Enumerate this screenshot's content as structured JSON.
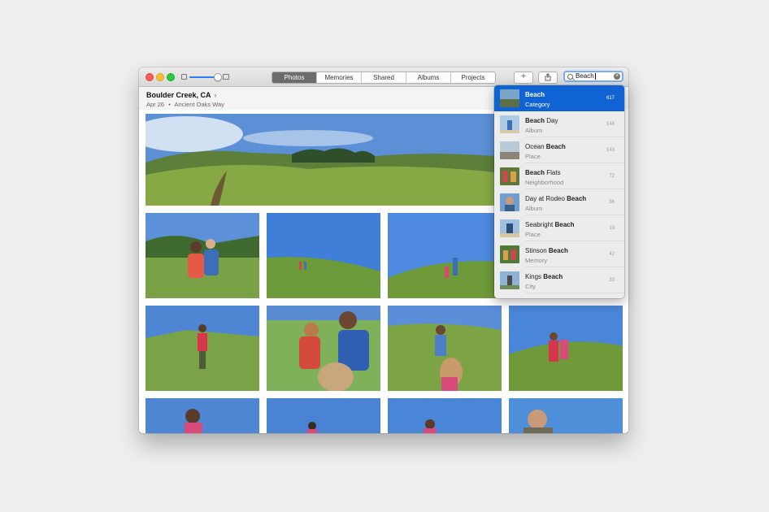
{
  "window": {
    "tabs": [
      {
        "label": "Photos",
        "active": true
      },
      {
        "label": "Memories",
        "active": false
      },
      {
        "label": "Shared",
        "active": false
      },
      {
        "label": "Albums",
        "active": false
      },
      {
        "label": "Projects",
        "active": false
      }
    ],
    "add_button": "+",
    "share_icon": "share-icon",
    "search": {
      "value": "Beach",
      "clear_icon": "clear-icon"
    }
  },
  "moment": {
    "location": "Boulder Creek, CA",
    "chevron": "›",
    "date": "Apr 26",
    "separator": "•",
    "place_name": "Ancient Oaks Way"
  },
  "suggestions": [
    {
      "match": "Beach",
      "prefix": "",
      "suffix": "",
      "type": "Category",
      "count": "617",
      "selected": true
    },
    {
      "match": "Beach",
      "prefix": "",
      "suffix": " Day",
      "type": "Album",
      "count": "148",
      "selected": false
    },
    {
      "match": "Beach",
      "prefix": "Ocean ",
      "suffix": "",
      "type": "Place",
      "count": "143",
      "selected": false
    },
    {
      "match": "Beach",
      "prefix": "",
      "suffix": " Flats",
      "type": "Neighborhood",
      "count": "72",
      "selected": false
    },
    {
      "match": "Beach",
      "prefix": "Day at Rodeo ",
      "suffix": "",
      "type": "Album",
      "count": "56",
      "selected": false
    },
    {
      "match": "Beach",
      "prefix": "Seabright ",
      "suffix": "",
      "type": "Place",
      "count": "19",
      "selected": false
    },
    {
      "match": "Beach",
      "prefix": "Stinson ",
      "suffix": "",
      "type": "Memory",
      "count": "42",
      "selected": false
    },
    {
      "match": "Beach",
      "prefix": "Kings ",
      "suffix": "",
      "type": "City",
      "count": "33",
      "selected": false
    }
  ],
  "colors": {
    "accent": "#0f63d3",
    "sky": "#4f86d3",
    "grass": "#6f9a3c"
  }
}
